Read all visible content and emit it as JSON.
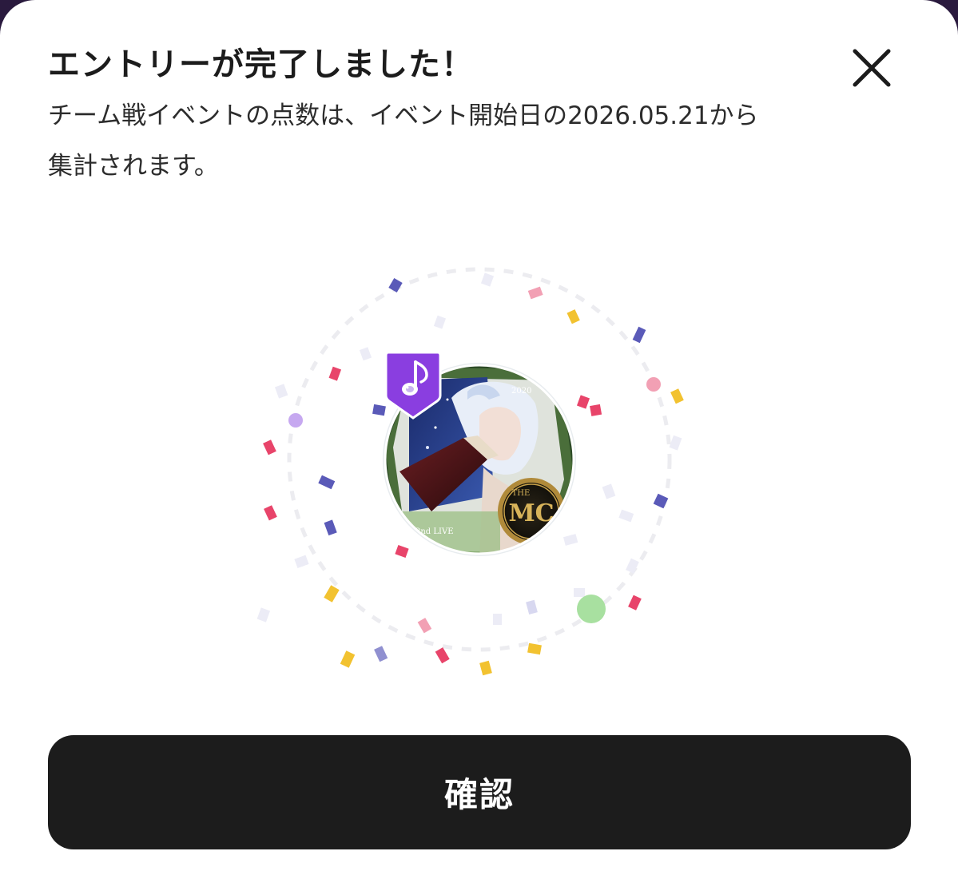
{
  "dialog": {
    "title": "エントリーが完了しました！",
    "message_line1": "チーム戦イベントの点数は、イベント開始日の2026.05.21から",
    "message_line2": "集計されます。",
    "close_icon": "close-icon",
    "confirm_label": "確認"
  },
  "avatar": {
    "badge_icon": "music-note-icon",
    "emblem_text": "MC",
    "emblem_top_text": "THE"
  },
  "colors": {
    "button_bg": "#1c1c1c",
    "badge_purple": "#8a3ee0",
    "confetti_pink": "#e8446a",
    "confetti_yellow": "#f2c230",
    "confetti_blue": "#5a5ab8",
    "dot_green": "#a8e0a0"
  }
}
